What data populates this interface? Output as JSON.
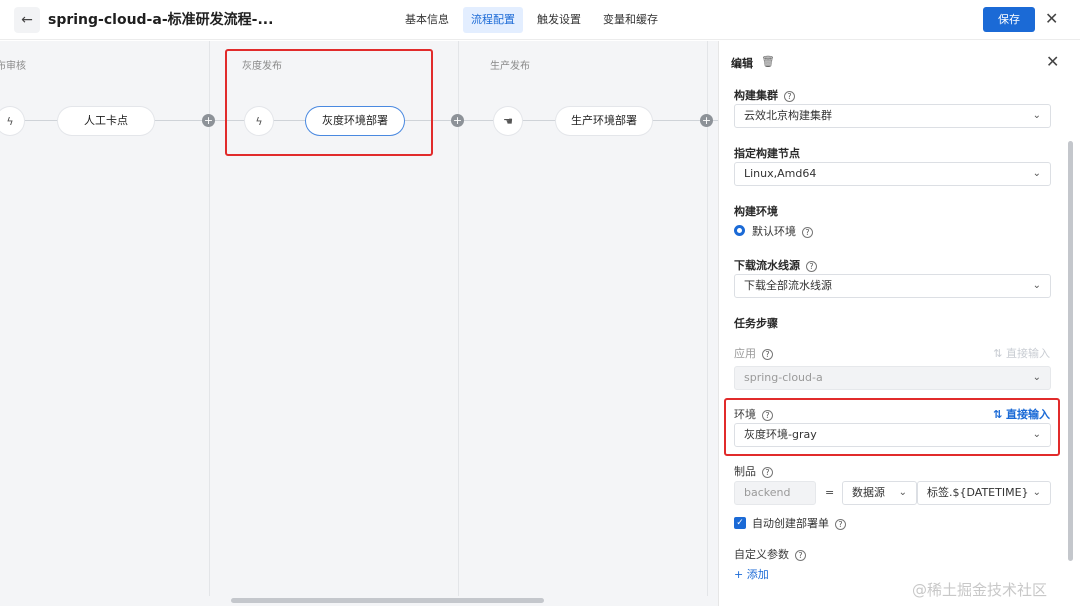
{
  "header": {
    "back_icon": "arrow-left-icon",
    "title": "spring-cloud-a-标准研发流程-...",
    "tabs": [
      {
        "label": "基本信息",
        "active": false
      },
      {
        "label": "流程配置",
        "active": true
      },
      {
        "label": "触发设置",
        "active": false
      },
      {
        "label": "变量和缓存",
        "active": false
      }
    ],
    "save_label": "保存",
    "close_icon": "close-icon"
  },
  "pipeline": {
    "stages": [
      {
        "title": "布审核",
        "node_label": "人工卡点",
        "node_icon": "bolt-icon"
      },
      {
        "title": "灰度发布",
        "node_label": "灰度环境部署",
        "node_icon": "bolt-icon",
        "selected": true
      },
      {
        "title": "生产发布",
        "node_label": "生产环境部署",
        "node_icon": "hand-pointer-icon"
      }
    ],
    "plus_glyph": "+"
  },
  "panel": {
    "header": "编辑",
    "trash_icon": "trash-icon",
    "close_icon": "close-icon",
    "build_cluster": {
      "label": "构建集群",
      "value": "云效北京构建集群"
    },
    "build_node": {
      "label": "指定构建节点",
      "value": "Linux,Amd64"
    },
    "build_env": {
      "label": "构建环境",
      "option": "默认环境"
    },
    "download_source": {
      "label": "下载流水线源",
      "value": "下载全部流水线源"
    },
    "task_steps": {
      "label": "任务步骤"
    },
    "app": {
      "label": "应用",
      "value": "spring-cloud-a",
      "direct_input": "直接输入"
    },
    "env": {
      "label": "环境",
      "value": "灰度环境-gray",
      "direct_input": "直接输入"
    },
    "artifact": {
      "label": "制品",
      "name": "backend",
      "equals": "=",
      "source": "数据源",
      "tag": "标签.${DATETIME}"
    },
    "auto_create": {
      "label": "自动创建部署单",
      "checked": true
    },
    "custom_params": {
      "label": "自定义参数",
      "add_label": "添加"
    },
    "help_glyph": "?",
    "chevron": "⌄"
  },
  "watermark": "@稀土掘金技术社区",
  "colors": {
    "accent": "#1b6ad6",
    "highlight_box": "#e12b2b",
    "canvas_bg": "#f4f5f7"
  }
}
